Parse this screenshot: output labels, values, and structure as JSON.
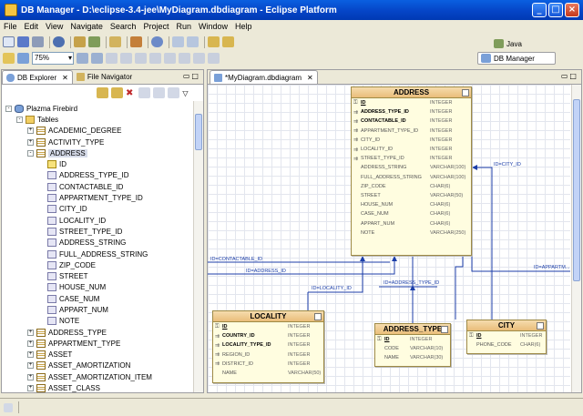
{
  "window": {
    "title": "DB Manager - D:\\eclipse-3.4-jee\\MyDiagram.dbdiagram - Eclipse Platform"
  },
  "menu": [
    "File",
    "Edit",
    "View",
    "Navigate",
    "Search",
    "Project",
    "Run",
    "Window",
    "Help"
  ],
  "toolbar": {
    "zoom": "75%"
  },
  "perspectives": {
    "java": "Java",
    "db_manager": "DB Manager"
  },
  "left_view": {
    "tabs": [
      "DB Explorer",
      "File Navigator"
    ],
    "tree": [
      {
        "level": 0,
        "exp": "-",
        "icon": "db",
        "label": "Plazma Firebird"
      },
      {
        "level": 1,
        "exp": "-",
        "icon": "fold",
        "label": "Tables"
      },
      {
        "level": 2,
        "exp": "+",
        "icon": "table",
        "label": "ACADEMIC_DEGREE"
      },
      {
        "level": 2,
        "exp": "+",
        "icon": "table",
        "label": "ACTIVITY_TYPE"
      },
      {
        "level": 2,
        "exp": "-",
        "icon": "table",
        "label": "ADDRESS"
      },
      {
        "level": 3,
        "exp": "",
        "icon": "pk",
        "label": "ID"
      },
      {
        "level": 3,
        "exp": "",
        "icon": "col",
        "label": "ADDRESS_TYPE_ID"
      },
      {
        "level": 3,
        "exp": "",
        "icon": "col",
        "label": "CONTACTABLE_ID"
      },
      {
        "level": 3,
        "exp": "",
        "icon": "col",
        "label": "APPARTMENT_TYPE_ID"
      },
      {
        "level": 3,
        "exp": "",
        "icon": "col",
        "label": "CITY_ID"
      },
      {
        "level": 3,
        "exp": "",
        "icon": "col",
        "label": "LOCALITY_ID"
      },
      {
        "level": 3,
        "exp": "",
        "icon": "col",
        "label": "STREET_TYPE_ID"
      },
      {
        "level": 3,
        "exp": "",
        "icon": "col",
        "label": "ADDRESS_STRING"
      },
      {
        "level": 3,
        "exp": "",
        "icon": "col",
        "label": "FULL_ADDRESS_STRING"
      },
      {
        "level": 3,
        "exp": "",
        "icon": "col",
        "label": "ZIP_CODE"
      },
      {
        "level": 3,
        "exp": "",
        "icon": "col",
        "label": "STREET"
      },
      {
        "level": 3,
        "exp": "",
        "icon": "col",
        "label": "HOUSE_NUM"
      },
      {
        "level": 3,
        "exp": "",
        "icon": "col",
        "label": "CASE_NUM"
      },
      {
        "level": 3,
        "exp": "",
        "icon": "col",
        "label": "APPART_NUM"
      },
      {
        "level": 3,
        "exp": "",
        "icon": "col",
        "label": "NOTE"
      },
      {
        "level": 2,
        "exp": "+",
        "icon": "table",
        "label": "ADDRESS_TYPE"
      },
      {
        "level": 2,
        "exp": "+",
        "icon": "table",
        "label": "APPARTMENT_TYPE"
      },
      {
        "level": 2,
        "exp": "+",
        "icon": "table",
        "label": "ASSET"
      },
      {
        "level": 2,
        "exp": "+",
        "icon": "table",
        "label": "ASSET_AMORTIZATION"
      },
      {
        "level": 2,
        "exp": "+",
        "icon": "table",
        "label": "ASSET_AMORTIZATION_ITEM"
      },
      {
        "level": 2,
        "exp": "+",
        "icon": "table",
        "label": "ASSET_CLASS"
      }
    ]
  },
  "editor": {
    "tab": "*MyDiagram.dbdiagram",
    "entities": [
      {
        "id": "address",
        "name": "ADDRESS",
        "columns": [
          {
            "key": "pk",
            "name": "ID",
            "type": "INTEGER"
          },
          {
            "key": "fk",
            "name": "ADDRESS_TYPE_ID",
            "type": "INTEGER"
          },
          {
            "key": "fk",
            "name": "CONTACTABLE_ID",
            "type": "INTEGER"
          },
          {
            "key": "col",
            "name": "APPARTMENT_TYPE_ID",
            "type": "INTEGER"
          },
          {
            "key": "col",
            "name": "CITY_ID",
            "type": "INTEGER"
          },
          {
            "key": "col",
            "name": "LOCALITY_ID",
            "type": "INTEGER"
          },
          {
            "key": "col",
            "name": "STREET_TYPE_ID",
            "type": "INTEGER"
          },
          {
            "key": "",
            "name": "ADDRESS_STRING",
            "type": "VARCHAR(100)"
          },
          {
            "key": "",
            "name": "FULL_ADDRESS_STRING",
            "type": "VARCHAR(100)"
          },
          {
            "key": "",
            "name": "ZIP_CODE",
            "type": "CHAR(6)"
          },
          {
            "key": "",
            "name": "STREET",
            "type": "VARCHAR(50)"
          },
          {
            "key": "",
            "name": "HOUSE_NUM",
            "type": "CHAR(6)"
          },
          {
            "key": "",
            "name": "CASE_NUM",
            "type": "CHAR(6)"
          },
          {
            "key": "",
            "name": "APPART_NUM",
            "type": "CHAR(6)"
          },
          {
            "key": "",
            "name": "NOTE",
            "type": "VARCHAR(250)"
          }
        ]
      },
      {
        "id": "locality",
        "name": "LOCALITY",
        "columns": [
          {
            "key": "pk",
            "name": "ID",
            "type": "INTEGER"
          },
          {
            "key": "fk",
            "name": "COUNTRY_ID",
            "type": "INTEGER"
          },
          {
            "key": "fk",
            "name": "LOCALITY_TYPE_ID",
            "type": "INTEGER"
          },
          {
            "key": "col",
            "name": "REGION_ID",
            "type": "INTEGER"
          },
          {
            "key": "col",
            "name": "DISTRICT_ID",
            "type": "INTEGER"
          },
          {
            "key": "",
            "name": "NAME",
            "type": "VARCHAR(50)"
          }
        ]
      },
      {
        "id": "address_type",
        "name": "ADDRESS_TYPE",
        "columns": [
          {
            "key": "pk",
            "name": "ID",
            "type": "INTEGER"
          },
          {
            "key": "",
            "name": "CODE",
            "type": "VARCHAR(10)"
          },
          {
            "key": "",
            "name": "NAME",
            "type": "VARCHAR(30)"
          }
        ]
      },
      {
        "id": "city",
        "name": "CITY",
        "columns": [
          {
            "key": "pk",
            "name": "ID",
            "type": "INTEGER"
          },
          {
            "key": "",
            "name": "PHONE_CODE",
            "type": "CHAR(6)"
          }
        ]
      }
    ],
    "relation_labels": {
      "contactable": "ID=CONTACTABLE_ID",
      "address_left": "ID=ADDRESS_ID",
      "locality": "ID=LOCALITY_ID",
      "address_type": "ID=ADDRESS_TYPE_ID",
      "city": "ID=CITY_ID",
      "appartment": "ID=APPARTM..."
    }
  },
  "colors": {
    "titlebar": "#0545c7",
    "entity_header": "#e9bd7a",
    "entity_body": "#fffde0",
    "relation_line": "#1c3ea8"
  }
}
